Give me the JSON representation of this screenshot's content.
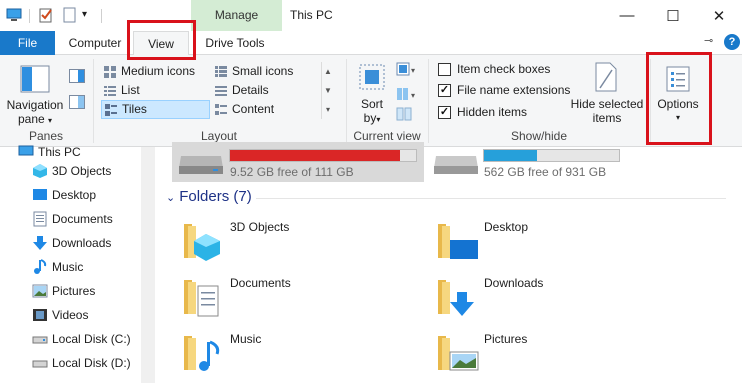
{
  "window": {
    "title": "This PC",
    "context_tab": "Manage",
    "controls": {
      "minimize": "—",
      "maximize": "☐",
      "close": "✕"
    }
  },
  "tabs": {
    "file": "File",
    "computer": "Computer",
    "view": "View",
    "drive_tools": "Drive Tools",
    "help": "?"
  },
  "ribbon": {
    "panes": {
      "navigation_pane_line1": "Navigation",
      "navigation_pane_line2": "pane",
      "label": "Panes"
    },
    "layout": {
      "items": [
        "Medium icons",
        "List",
        "Tiles",
        "Small icons",
        "Details",
        "Content"
      ],
      "selected": "Tiles",
      "label": "Layout"
    },
    "current_view": {
      "sort_line1": "Sort",
      "sort_line2": "by",
      "label": "Current view"
    },
    "show_hide": {
      "item_check_boxes": {
        "label": "Item check boxes",
        "checked": false
      },
      "file_name_extensions": {
        "label": "File name extensions",
        "checked": true
      },
      "hidden_items": {
        "label": "Hidden items",
        "checked": true
      },
      "hide_selected_line1": "Hide selected",
      "hide_selected_line2": "items",
      "label": "Show/hide"
    },
    "options": {
      "label": "Options",
      "arrow": "▾"
    }
  },
  "nav": {
    "this_pc": "This PC",
    "items": [
      "3D Objects",
      "Desktop",
      "Documents",
      "Downloads",
      "Music",
      "Pictures",
      "Videos",
      "Local Disk (C:)",
      "Local Disk (D:)"
    ]
  },
  "drives": [
    {
      "free_text": "9.52 GB free of 111 GB",
      "used_fraction": 0.914,
      "bar_color": "#da2626"
    },
    {
      "free_text": "562 GB free of 931 GB",
      "used_fraction": 0.396,
      "bar_color": "#26a0da"
    }
  ],
  "folders_header": "Folders (7)",
  "folders": [
    "3D Objects",
    "Desktop",
    "Documents",
    "Downloads",
    "Music",
    "Pictures"
  ],
  "colors": {
    "accent": "#1979ca",
    "highlight": "#d9121b",
    "manage_bg": "#d4ecd4"
  }
}
